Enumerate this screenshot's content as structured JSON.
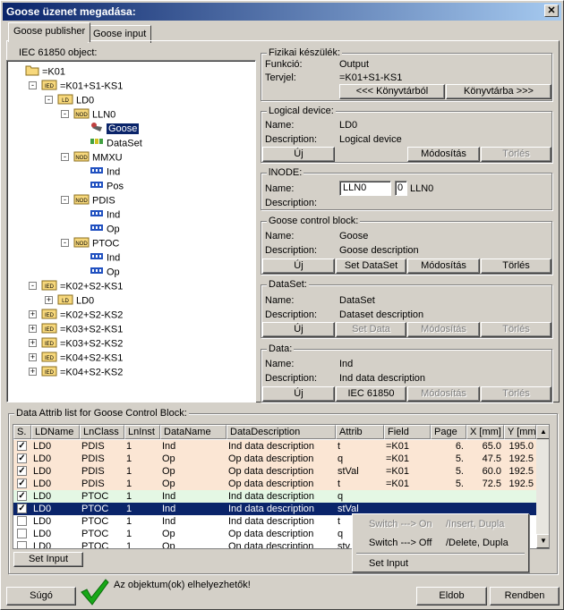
{
  "window": {
    "title": "Goose üzenet megadása:",
    "close": "✕"
  },
  "tabs": [
    "Goose publisher",
    "Goose input"
  ],
  "tree": {
    "label": "IEC 61850 object:",
    "nodes": [
      {
        "text": "=K01",
        "x": 0,
        "y": 0,
        "icon": "folder",
        "exp": ""
      },
      {
        "text": "=K01+S1-KS1",
        "x": 1,
        "y": 1,
        "icon": "ied",
        "exp": "-"
      },
      {
        "text": "LD0",
        "x": 2,
        "y": 2,
        "icon": "ld",
        "exp": "-"
      },
      {
        "text": "LLN0",
        "x": 3,
        "y": 3,
        "icon": "nod",
        "exp": "-"
      },
      {
        "text": "Goose",
        "x": 4,
        "y": 4,
        "icon": "goose",
        "exp": "",
        "sel": true
      },
      {
        "text": "DataSet",
        "x": 4,
        "y": 5,
        "icon": "dataset",
        "exp": ""
      },
      {
        "text": "MMXU",
        "x": 3,
        "y": 6,
        "icon": "nod",
        "exp": "-"
      },
      {
        "text": "Ind",
        "x": 4,
        "y": 7,
        "icon": "do",
        "exp": ""
      },
      {
        "text": "Pos",
        "x": 4,
        "y": 8,
        "icon": "do",
        "exp": ""
      },
      {
        "text": "PDIS",
        "x": 3,
        "y": 9,
        "icon": "nod",
        "exp": "-"
      },
      {
        "text": "Ind",
        "x": 4,
        "y": 10,
        "icon": "do",
        "exp": ""
      },
      {
        "text": "Op",
        "x": 4,
        "y": 11,
        "icon": "do",
        "exp": ""
      },
      {
        "text": "PTOC",
        "x": 3,
        "y": 12,
        "icon": "nod",
        "exp": "-"
      },
      {
        "text": "Ind",
        "x": 4,
        "y": 13,
        "icon": "do",
        "exp": ""
      },
      {
        "text": "Op",
        "x": 4,
        "y": 14,
        "icon": "do",
        "exp": ""
      },
      {
        "text": "=K02+S2-KS1",
        "x": 1,
        "y": 15,
        "icon": "ied",
        "exp": "-"
      },
      {
        "text": "LD0",
        "x": 2,
        "y": 16,
        "icon": "ld",
        "exp": "+"
      },
      {
        "text": "=K02+S2-KS2",
        "x": 1,
        "y": 17,
        "icon": "ied",
        "exp": "+"
      },
      {
        "text": "=K03+S2-KS1",
        "x": 1,
        "y": 18,
        "icon": "ied",
        "exp": "+"
      },
      {
        "text": "=K03+S2-KS2",
        "x": 1,
        "y": 19,
        "icon": "ied",
        "exp": "+"
      },
      {
        "text": "=K04+S2-KS1",
        "x": 1,
        "y": 20,
        "icon": "ied",
        "exp": "+"
      },
      {
        "text": "=K04+S2-KS2",
        "x": 1,
        "y": 21,
        "icon": "ied",
        "exp": "+"
      }
    ],
    "icon_text": {
      "ied": "IED",
      "ld": "LD",
      "nod": "NOD"
    }
  },
  "fizikai": {
    "title": "Fizikai készülék:",
    "funkcio_label": "Funkció:",
    "funkcio_value": "Output",
    "tervjel_label": "Tervjel:",
    "tervjel_value": "=K01+S1-KS1",
    "btn_from": "<<< Könyvtárból",
    "btn_to": "Könyvtárba >>>"
  },
  "logical_device": {
    "title": "Logical device:",
    "name_label": "Name:",
    "name_value": "LD0",
    "desc_label": "Description:",
    "desc_value": "Logical device",
    "btn_new": "Új",
    "btn_modify": "Módosítás",
    "btn_delete": "Törlés"
  },
  "lnode": {
    "title": "lNODE:",
    "name_label": "Name:",
    "field1": "LLN0",
    "field2": "0",
    "name_value": "LLN0",
    "desc_label": "Description:"
  },
  "gcb": {
    "title": "Goose control block:",
    "name_label": "Name:",
    "name_value": "Goose",
    "desc_label": "Description:",
    "desc_value": "Goose description",
    "btn_new": "Új",
    "btn_setds": "Set DataSet",
    "btn_modify": "Módosítás",
    "btn_delete": "Törlés"
  },
  "dataset": {
    "title": "DataSet:",
    "name_label": "Name:",
    "name_value": "DataSet",
    "desc_label": "Description:",
    "desc_value": "Dataset description",
    "btn_new": "Új",
    "btn_setdata": "Set Data",
    "btn_modify": "Módosítás",
    "btn_delete": "Törlés"
  },
  "data": {
    "title": "Data:",
    "name_label": "Name:",
    "name_value": "Ind",
    "desc_label": "Description:",
    "desc_value": "Ind data description",
    "btn_new": "Új",
    "btn_iec": "IEC 61850",
    "btn_modify": "Módosítás",
    "btn_delete": "Törlés"
  },
  "grid": {
    "title": "Data Attrib list for Goose Control Block:",
    "columns": [
      "S.",
      "LDName",
      "LnClass",
      "LnInst",
      "DataName",
      "DataDescription",
      "Attrib",
      "Field",
      "Page",
      "X [mm]",
      "Y [mm]"
    ],
    "rows": [
      {
        "c": true,
        "bg": "#fbe6d4",
        "cells": [
          "LD0",
          "PDIS",
          "1",
          "Ind",
          "Ind data description",
          "t",
          "=K01",
          "6.",
          "65.0",
          "195.0"
        ]
      },
      {
        "c": true,
        "bg": "#fbe6d4",
        "cells": [
          "LD0",
          "PDIS",
          "1",
          "Op",
          "Op data description",
          "q",
          "=K01",
          "5.",
          "47.5",
          "192.5"
        ]
      },
      {
        "c": true,
        "bg": "#fbe6d4",
        "cells": [
          "LD0",
          "PDIS",
          "1",
          "Op",
          "Op data description",
          "stVal",
          "=K01",
          "5.",
          "60.0",
          "192.5"
        ]
      },
      {
        "c": true,
        "bg": "#fbe6d4",
        "cells": [
          "LD0",
          "PDIS",
          "1",
          "Op",
          "Op data description",
          "t",
          "=K01",
          "5.",
          "72.5",
          "192.5"
        ]
      },
      {
        "c": true,
        "bg": "#e4f7e4",
        "cells": [
          "LD0",
          "PTOC",
          "1",
          "Ind",
          "Ind data description",
          "q",
          "",
          "",
          "",
          ""
        ]
      },
      {
        "c": true,
        "bg": "#0a246a",
        "sel": true,
        "cells": [
          "LD0",
          "PTOC",
          "1",
          "Ind",
          "Ind data description",
          "stVal",
          "",
          "",
          "",
          ""
        ]
      },
      {
        "c": false,
        "bg": "#ffffff",
        "cells": [
          "LD0",
          "PTOC",
          "1",
          "Ind",
          "Ind data description",
          "t",
          "",
          "",
          "",
          ""
        ]
      },
      {
        "c": false,
        "bg": "#ffffff",
        "cells": [
          "LD0",
          "PTOC",
          "1",
          "Op",
          "Op data description",
          "q",
          "",
          "",
          "",
          ""
        ]
      },
      {
        "c": false,
        "bg": "#ffffff",
        "cells": [
          "LD0",
          "PTOC",
          "1",
          "Op",
          "On data description",
          "stv",
          "",
          "",
          "",
          ""
        ]
      }
    ]
  },
  "context_menu": [
    {
      "a": "Switch ---> On",
      "b": "/Insert, Dupla",
      "dis": true
    },
    {
      "a": "Switch ---> Off",
      "b": "/Delete, Dupla",
      "dis": false
    },
    {
      "a": "Set Input",
      "b": "",
      "dis": false
    }
  ],
  "set_input_btn": "Set Input",
  "footer": {
    "help": "Súgó",
    "status": "Az objektum(ok) elhelyezhetők!",
    "discard": "Eldob",
    "ok": "Rendben"
  }
}
